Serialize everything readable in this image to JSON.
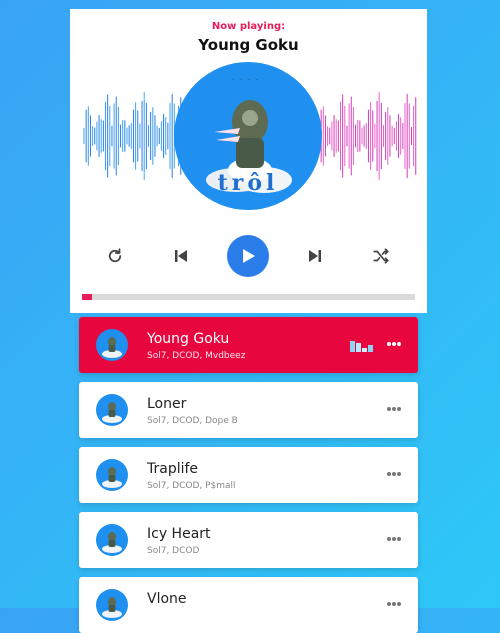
{
  "player": {
    "now_playing_label": "Now playing:",
    "title": "Young Goku",
    "cover_text": "trôl",
    "progress": 0.03,
    "accent_color": "#e81e5a",
    "play_button_color": "#2b7de9",
    "controls": [
      "repeat-icon",
      "previous-icon",
      "play-icon",
      "next-icon",
      "shuffle-icon"
    ]
  },
  "tracks": [
    {
      "name": "Young Goku",
      "artists": "Sol7, DCOD, Mvdbeez",
      "active": true
    },
    {
      "name": "Loner",
      "artists": "Sol7, DCOD, Dope B",
      "active": false
    },
    {
      "name": "Traplife",
      "artists": "Sol7, DCOD, P$mall",
      "active": false
    },
    {
      "name": "Icy Heart",
      "artists": "Sol7, DCOD",
      "active": false
    },
    {
      "name": "Vlone",
      "artists": "",
      "active": false
    }
  ]
}
